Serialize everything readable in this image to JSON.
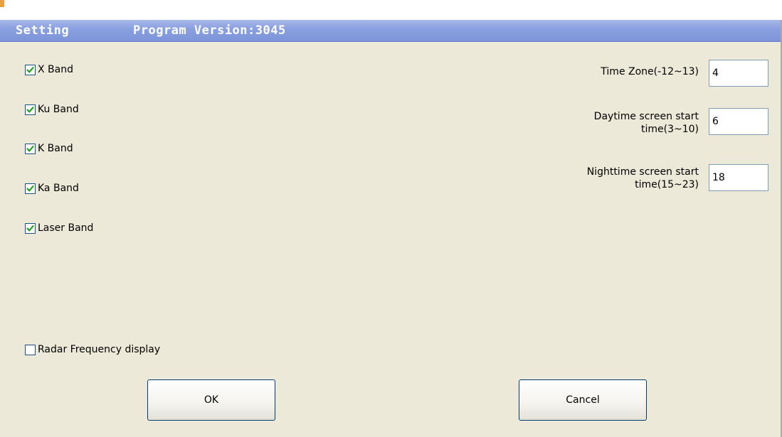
{
  "window": {
    "title": "Setting",
    "version_label": "Program Version:3045"
  },
  "bands": [
    {
      "label": "X Band",
      "checked": true
    },
    {
      "label": "Ku Band",
      "checked": true
    },
    {
      "label": "K Band",
      "checked": true
    },
    {
      "label": "Ka Band",
      "checked": true
    },
    {
      "label": "Laser Band",
      "checked": true
    }
  ],
  "radar_frequency": {
    "label": "Radar Frequency display",
    "checked": false
  },
  "time_zone": {
    "label": "Time Zone(-12~13)",
    "value": "4"
  },
  "daytime": {
    "label_line1": "Daytime screen start",
    "label_line2": "time(3~10)",
    "value": "6"
  },
  "nighttime": {
    "label_line1": "Nighttime screen start",
    "label_line2": "time(15~23)",
    "value": "18"
  },
  "buttons": {
    "ok_label": "OK",
    "cancel_label": "Cancel"
  },
  "colors": {
    "titlebar": "#8aa0e0",
    "dialog_bg": "#ece9d8",
    "check_green": "#21a121",
    "field_border": "#7f9db9"
  }
}
